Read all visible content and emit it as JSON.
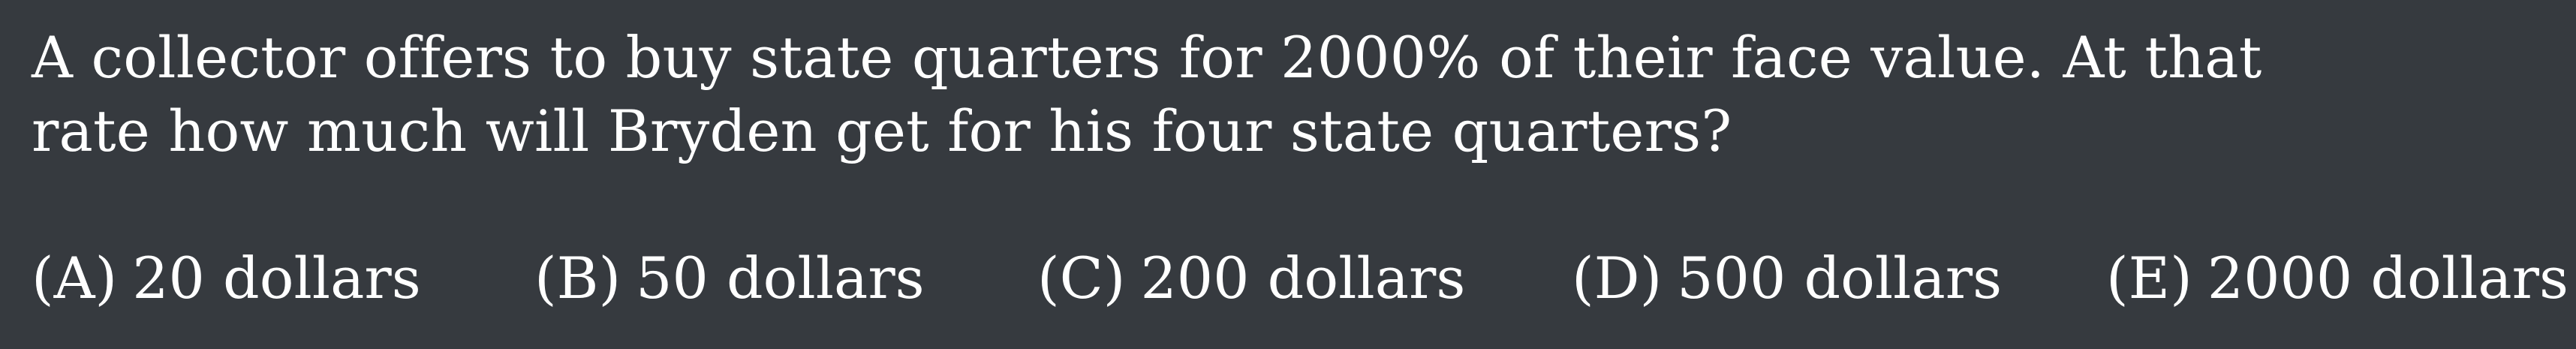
{
  "question": {
    "line1": "A collector offers to buy state quarters for 2000% of their face value.  At that",
    "line2": "rate how much will Bryden get for his four state quarters?"
  },
  "choices": [
    {
      "letter": "(A)",
      "text": "20 dollars"
    },
    {
      "letter": "(B)",
      "text": "50 dollars"
    },
    {
      "letter": "(C)",
      "text": "200 dollars"
    },
    {
      "letter": "(D)",
      "text": "500 dollars"
    },
    {
      "letter": "(E)",
      "text": "2000 dollars"
    }
  ]
}
